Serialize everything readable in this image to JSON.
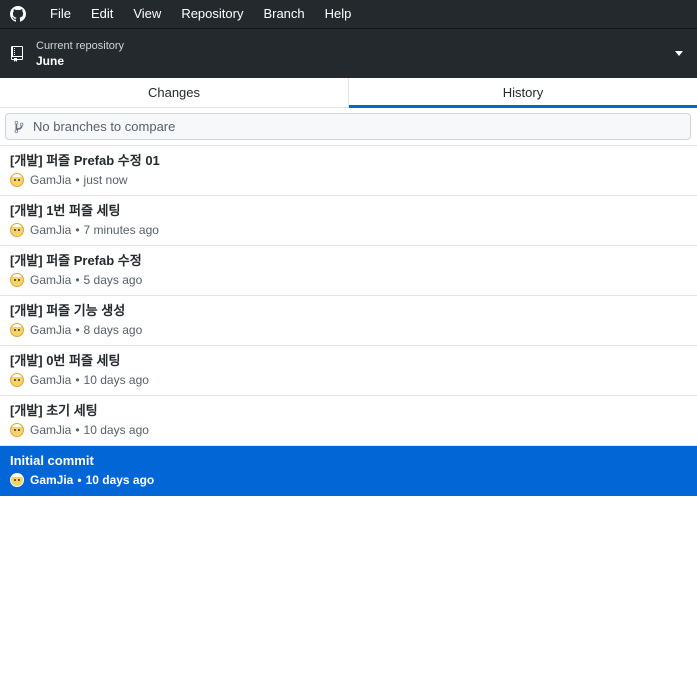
{
  "menu": {
    "items": [
      "File",
      "Edit",
      "View",
      "Repository",
      "Branch",
      "Help"
    ]
  },
  "toolbar": {
    "caption": "Current repository",
    "repository": "June"
  },
  "tabs": {
    "changes": "Changes",
    "history": "History",
    "active": "History"
  },
  "compare": {
    "placeholder": "No branches to compare"
  },
  "commits": [
    {
      "title": "[개발] 퍼즐 Prefab 수정 01",
      "author": "GamJia",
      "time": "just now"
    },
    {
      "title": "[개발] 1번 퍼즐 세팅",
      "author": "GamJia",
      "time": "7 minutes ago"
    },
    {
      "title": "[개발] 퍼즐 Prefab 수정",
      "author": "GamJia",
      "time": "5 days ago"
    },
    {
      "title": "[개발] 퍼즐 기능 생성",
      "author": "GamJia",
      "time": "8 days ago"
    },
    {
      "title": "[개발] 0번 퍼즐 세팅",
      "author": "GamJia",
      "time": "10 days ago"
    },
    {
      "title": "[개발] 초기 세팅",
      "author": "GamJia",
      "time": "10 days ago"
    },
    {
      "title": "Initial commit",
      "author": "GamJia",
      "time": "10 days ago",
      "selected": true
    }
  ],
  "meta_separator": "•",
  "colors": {
    "titlebar": "#24292e",
    "accent": "#0366d6",
    "border": "#e1e4e8"
  },
  "icons": {
    "app": "github-logo-icon",
    "repo": "repo-icon",
    "dropdown": "caret-down-icon",
    "branch": "git-branch-icon",
    "avatar": "avatar-icon"
  }
}
